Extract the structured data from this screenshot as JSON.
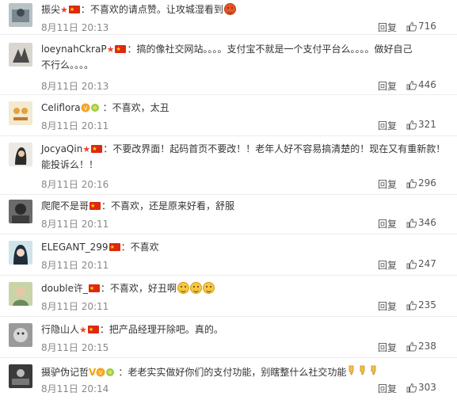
{
  "comments": [
    {
      "user": "振尖",
      "text": "不喜欢的请点赞。让攻城湿看到",
      "date": "8月11日 20:13",
      "reply": "回复",
      "likes": "716"
    },
    {
      "user": "loeynahCkraP",
      "text": "搞的像社交网站。。。。支付宝不就是一个支付平台么。。。。做好自己",
      "text2": "不行么。。。。",
      "date": "8月11日 20:13",
      "reply": "回复",
      "likes": "446"
    },
    {
      "user": "Celiflora",
      "text": "不喜欢，太丑",
      "date": "8月11日 20:11",
      "reply": "回复",
      "likes": "321"
    },
    {
      "user": "JocyaQin",
      "text": "不要改界面！起码首页不要改！！老年人好不容易搞清楚的！现在又有重新款！",
      "text2": "能投诉么！！",
      "date": "8月11日 20:16",
      "reply": "回复",
      "likes": "296"
    },
    {
      "user": "爬爬不是哥",
      "text": "不喜欢，还是原来好看，舒服",
      "date": "8月11日 20:11",
      "reply": "回复",
      "likes": "346"
    },
    {
      "user": "ELEGANT_299",
      "text": "不喜欢",
      "date": "8月11日 20:11",
      "reply": "回复",
      "likes": "247"
    },
    {
      "user": "double许_",
      "text": "不喜欢，好丑啊",
      "date": "8月11日 20:11",
      "reply": "回复",
      "likes": "235"
    },
    {
      "user": "行隐山人",
      "text": "把产品经理开除吧。真的。",
      "date": "8月11日 20:15",
      "reply": "回复",
      "likes": "238"
    },
    {
      "user": "摄驴伪记哲",
      "text": "老老实实做好你们的支付功能，别瞎整什么社交功能",
      "date": "8月11日 20:14",
      "reply": "回复",
      "likes": "303"
    }
  ],
  "colon": "：",
  "vip_mark": "V",
  "icons": {
    "thumb": "thumbs-up-icon",
    "flag": "china-flag-icon",
    "star": "red-star-icon"
  },
  "colors": {
    "star": "#e8452c",
    "flag": "#de2910",
    "date": "#888888"
  }
}
